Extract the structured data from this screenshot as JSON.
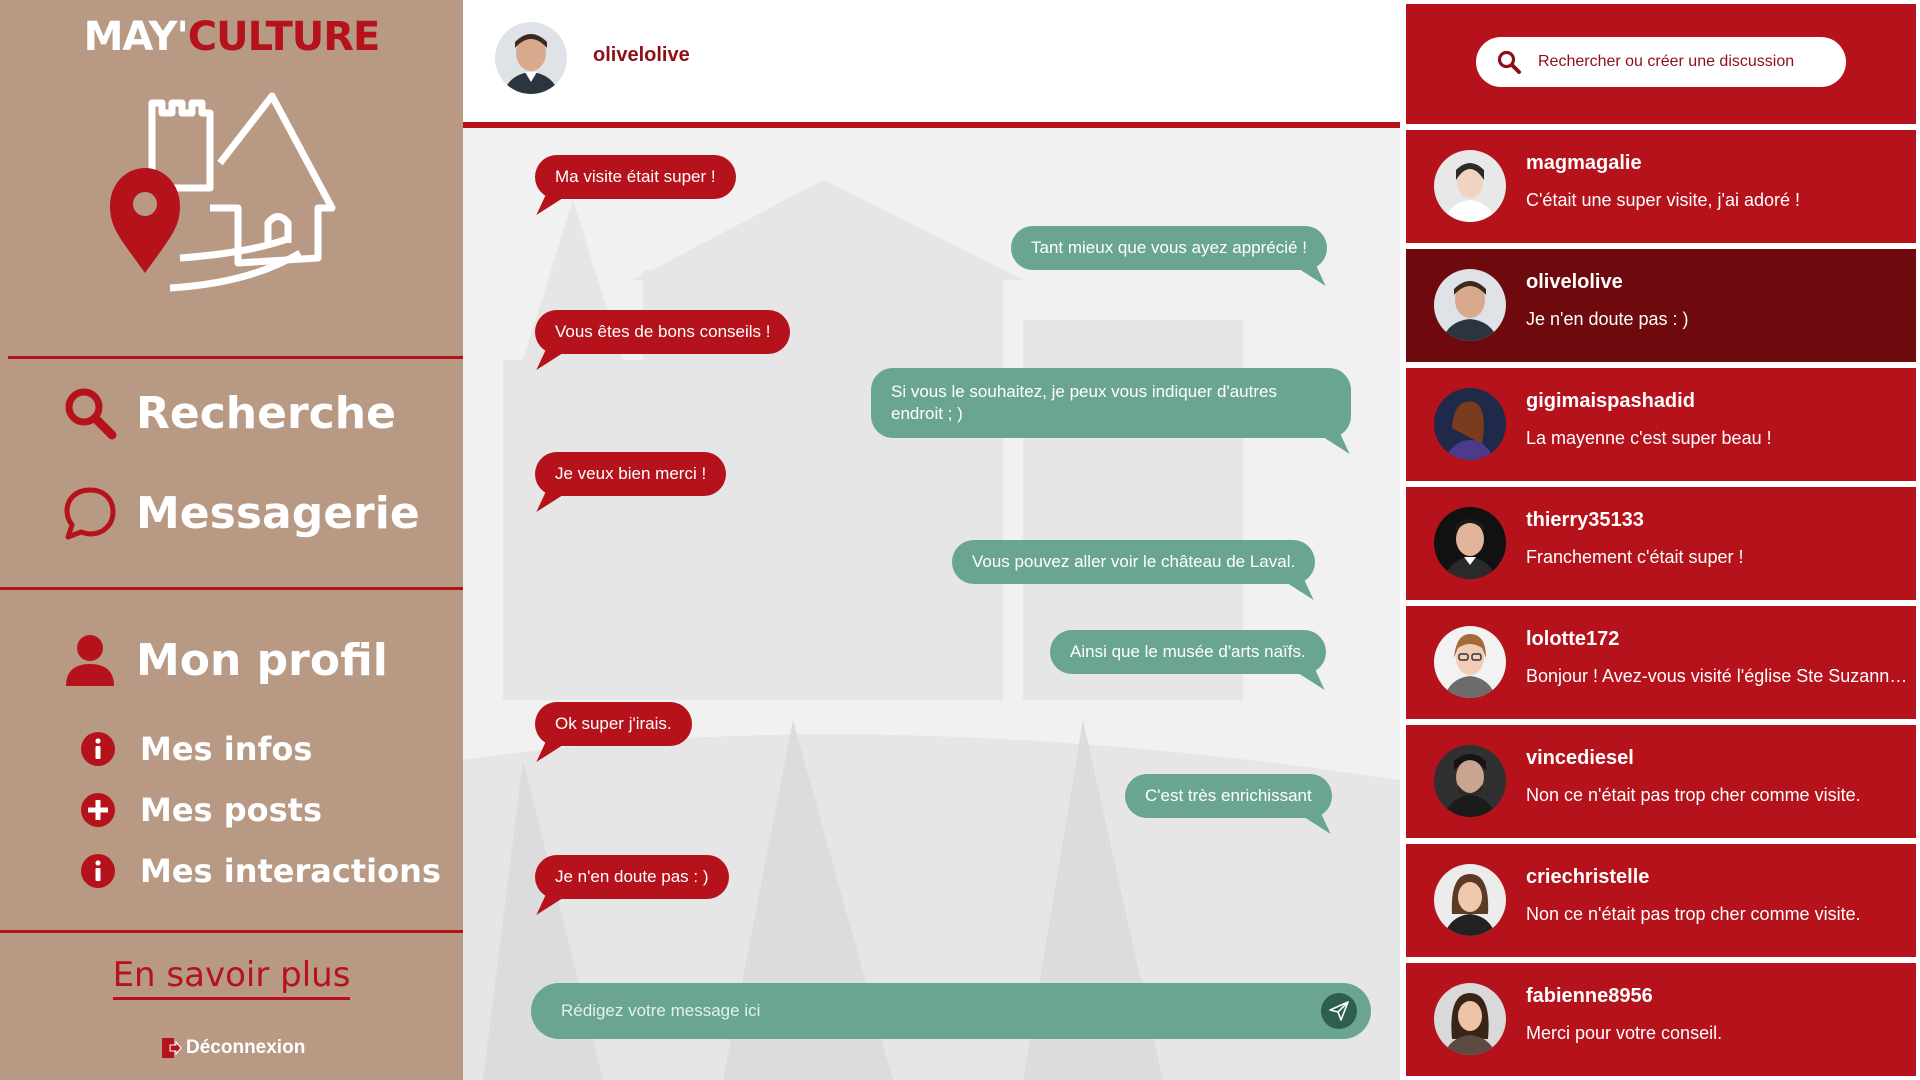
{
  "brand": {
    "part1": "MAY'",
    "part2": "CULTURE"
  },
  "nav": {
    "search": "Recherche",
    "messages": "Messagerie",
    "profile": "Mon profil",
    "my_info": "Mes infos",
    "my_posts": "Mes posts",
    "my_interactions": "Mes interactions",
    "learn_more": "En savoir plus",
    "logout": "Déconnexion"
  },
  "chat": {
    "username": "olivelolive",
    "messages": [
      {
        "from": "them",
        "text": "Ma visite était super !"
      },
      {
        "from": "me",
        "text": "Tant mieux que vous ayez apprécié !"
      },
      {
        "from": "them",
        "text": "Vous êtes de bons conseils !"
      },
      {
        "from": "me",
        "text": "Si vous le souhaitez, je peux vous indiquer d'autres endroit ; )"
      },
      {
        "from": "them",
        "text": "Je veux bien merci !"
      },
      {
        "from": "me",
        "text": "Vous pouvez aller voir le château de Laval."
      },
      {
        "from": "me",
        "text": "Ainsi que le musée d'arts naïfs."
      },
      {
        "from": "them",
        "text": "Ok super j'irais."
      },
      {
        "from": "me",
        "text": "C'est très enrichissant"
      },
      {
        "from": "them",
        "text": "Je n'en doute pas : )"
      }
    ],
    "composer_placeholder": "Rédigez votre message ici"
  },
  "search": {
    "placeholder": "Rechercher ou créer une discussion"
  },
  "conversations": [
    {
      "name": "magmagalie",
      "last": "C'était une super visite, j'ai adoré !",
      "active": false
    },
    {
      "name": "olivelolive",
      "last": "Je n'en doute pas : )",
      "active": true
    },
    {
      "name": "gigimaispashadid",
      "last": "La mayenne c'est super beau !",
      "active": false
    },
    {
      "name": "thierry35133",
      "last": "Franchement c'était super !",
      "active": false
    },
    {
      "name": "lolotte172",
      "last": "Bonjour ! Avez-vous visité l'église Ste Suzanne ?",
      "active": false
    },
    {
      "name": "vincediesel",
      "last": "Non ce n'était pas trop cher comme visite.",
      "active": false
    },
    {
      "name": "criechristelle",
      "last": "Non ce n'était pas trop cher comme visite.",
      "active": false
    },
    {
      "name": "fabienne8956",
      "last": "Merci pour votre conseil.",
      "active": false
    }
  ],
  "colors": {
    "brand_red": "#b5121b",
    "dark_red": "#6e0a0e",
    "sidebar": "#b89a84",
    "outgoing": "#6aa593"
  }
}
